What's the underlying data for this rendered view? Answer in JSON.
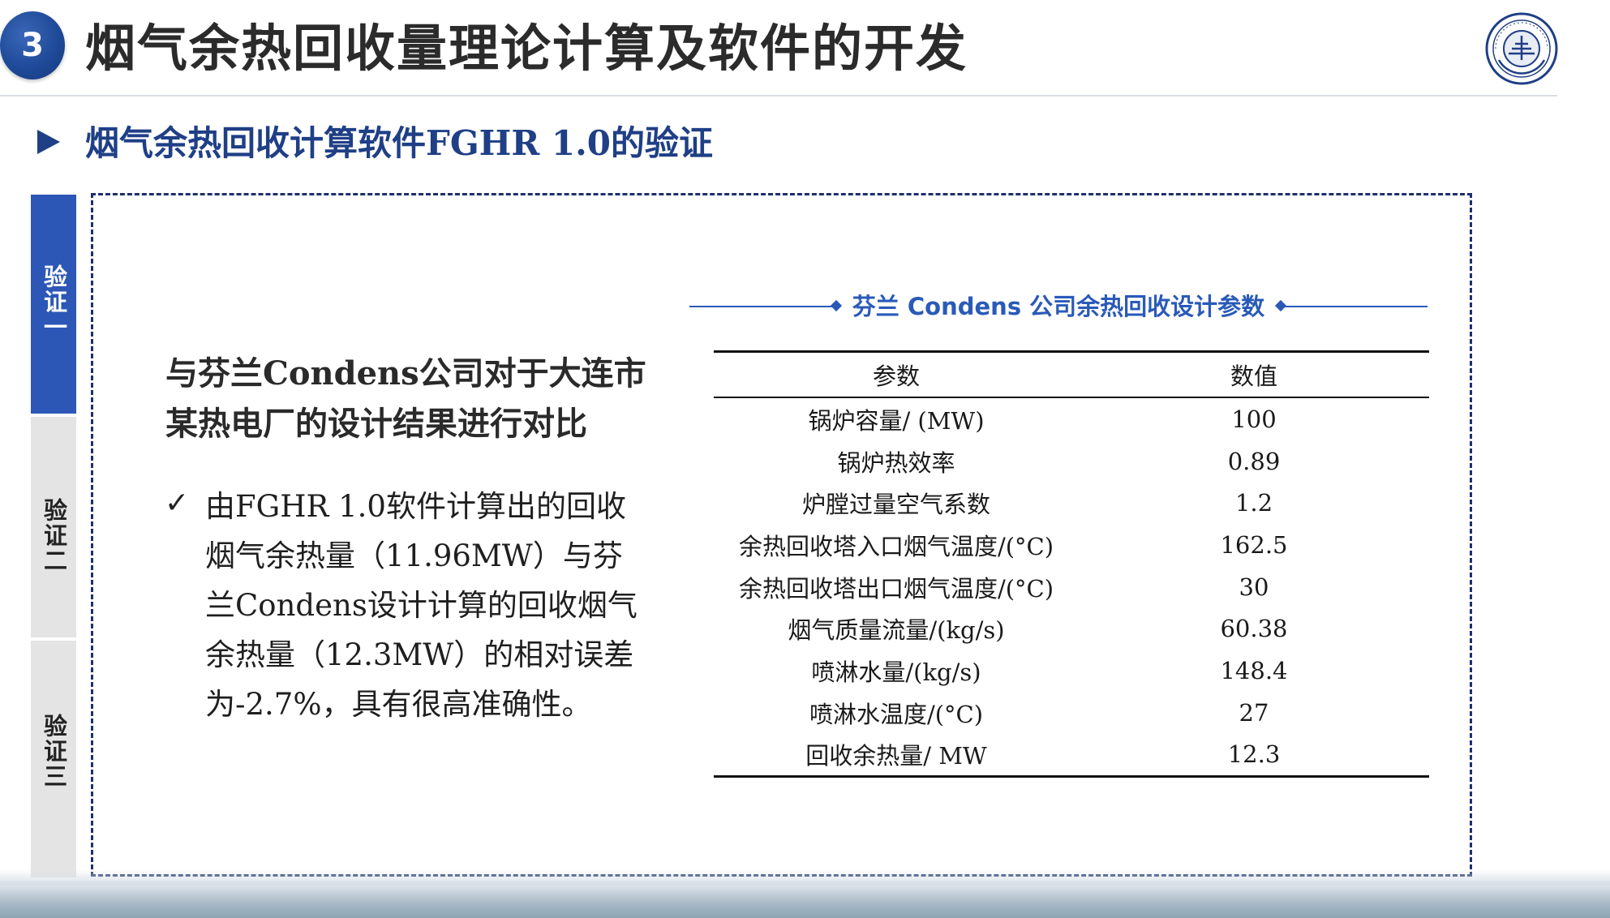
{
  "header": {
    "section_number": "3",
    "title": "烟气余热回收量理论计算及软件的开发"
  },
  "subtitle": "烟气余热回收计算软件FGHR 1.0的验证",
  "side_tabs": [
    {
      "label": "验证一",
      "active": true
    },
    {
      "label": "验证二",
      "active": false
    },
    {
      "label": "验证三",
      "active": false
    }
  ],
  "content": {
    "lead": "与芬兰Condens公司对于大连市某热电厂的设计结果进行对比",
    "bullet_mark": "✓",
    "paragraph": "由FGHR 1.0软件计算出的回收烟气余热量（11.96MW）与芬兰Condens设计计算的回收烟气余热量（12.3MW）的相对误差为-2.7%，具有很高准确性。"
  },
  "table": {
    "caption": "芬兰 Condens 公司余热回收设计参数",
    "headers": [
      "参数",
      "数值"
    ],
    "rows": [
      [
        "锅炉容量/ (MW)",
        "100"
      ],
      [
        "锅炉热效率",
        "0.89"
      ],
      [
        "炉膛过量空气系数",
        "1.2"
      ],
      [
        "余热回收塔入口烟气温度/(°C)",
        "162.5"
      ],
      [
        "余热回收塔出口烟气温度/(°C)",
        "30"
      ],
      [
        "烟气质量流量/(kg/s)",
        "60.38"
      ],
      [
        "喷淋水量/(kg/s)",
        "148.4"
      ],
      [
        "喷淋水温度/(°C)",
        "27"
      ],
      [
        "回收余热量/ MW",
        "12.3"
      ]
    ]
  },
  "colors": {
    "accent": "#1f3f86",
    "active_tab": "#2c57b6",
    "inactive_tab": "#e4e4e4",
    "caption": "#2a5ab8"
  },
  "icons": [
    "university-seal-logo",
    "triangle-bullet-icon",
    "checkmark-icon"
  ]
}
